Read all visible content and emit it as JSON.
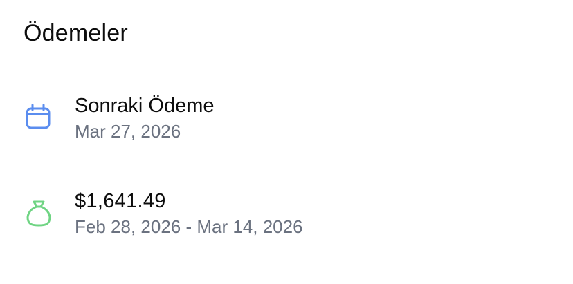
{
  "payments": {
    "title": "Ödemeler",
    "next_payment": {
      "icon": "calendar-icon",
      "label": "Sonraki Ödeme",
      "date": "Mar 27, 2026",
      "icon_color": "#5b8def"
    },
    "amount": {
      "icon": "money-bag-icon",
      "value": "$1,641.49",
      "period": "Feb 28, 2026 - Mar 14, 2026",
      "icon_color": "#6fd483"
    }
  }
}
